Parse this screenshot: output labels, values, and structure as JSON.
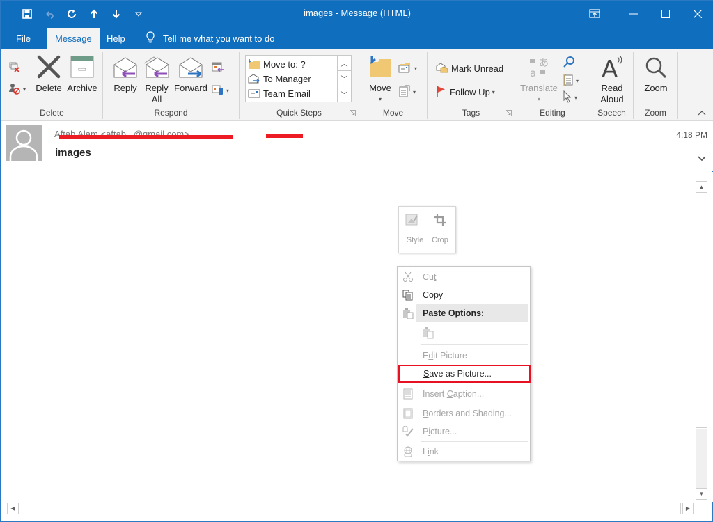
{
  "window": {
    "title": "images  -  Message (HTML)",
    "accent_color": "#106ebe",
    "quick_access": [
      {
        "icon": "save-icon"
      },
      {
        "icon": "undo-icon",
        "disabled": true
      },
      {
        "icon": "redo-icon"
      },
      {
        "icon": "previous-item-icon"
      },
      {
        "icon": "next-item-icon"
      },
      {
        "icon": "customize-qat-icon"
      }
    ],
    "controls": [
      "ribbon-display-options-icon",
      "minimize-icon",
      "maximize-icon",
      "close-icon"
    ]
  },
  "menu": {
    "tabs": [
      {
        "label": "File",
        "active": false
      },
      {
        "label": "Message",
        "active": true
      },
      {
        "label": "Help",
        "active": false
      }
    ],
    "tell_me": "Tell me what you want to do"
  },
  "ribbon": {
    "groups": {
      "delete": {
        "label": "Delete",
        "ignore_icon": "ignore-icon",
        "junk_icon": "block-sender-icon",
        "delete_label": "Delete",
        "archive_label": "Archive"
      },
      "respond": {
        "label": "Respond",
        "reply_label": "Reply",
        "reply_all_label_1": "Reply",
        "reply_all_label_2": "All",
        "forward_label": "Forward"
      },
      "quick_steps": {
        "label": "Quick Steps",
        "items": [
          "Move to: ?",
          "To Manager",
          "Team Email"
        ]
      },
      "move": {
        "label": "Move",
        "move_label": "Move"
      },
      "tags": {
        "label": "Tags",
        "mark_unread": "Mark Unread",
        "follow_up": "Follow Up"
      },
      "editing": {
        "label": "Editing",
        "translate": "Translate"
      },
      "speech": {
        "label": "Speech",
        "read_aloud_1": "Read",
        "read_aloud_2": "Aloud"
      },
      "zoom": {
        "label": "Zoom",
        "zoom_label": "Zoom"
      }
    }
  },
  "message": {
    "sender_visible": "Aftab Alam <aftab...@gmail.com>",
    "subject": "images",
    "time": "4:18 PM"
  },
  "mini_toolbar": {
    "style_label": "Style",
    "crop_label": "Crop"
  },
  "context_menu": {
    "items": [
      {
        "pre": "Cu",
        "u": "t",
        "post": "",
        "disabled": true,
        "icon": "cut-icon"
      },
      {
        "pre": "",
        "u": "C",
        "post": "opy",
        "disabled": false,
        "icon": "copy-icon"
      },
      {
        "label": "Paste Options:",
        "header": true,
        "icon": "paste-icon"
      },
      {
        "icon": "paste-keep-icon",
        "disabled": true
      },
      {
        "pre": "E",
        "u": "d",
        "post": "it Picture",
        "disabled": true
      },
      {
        "pre": "",
        "u": "S",
        "post": "ave as Picture...",
        "disabled": false,
        "highlighted": true
      },
      {
        "pre": "Insert ",
        "u": "C",
        "post": "aption...",
        "disabled": true,
        "icon": "insert-caption-icon"
      },
      {
        "pre": "",
        "u": "B",
        "post": "orders and Shading...",
        "disabled": true,
        "icon": "borders-icon"
      },
      {
        "pre": "P",
        "u": "i",
        "post": "cture...",
        "disabled": true,
        "icon": "format-picture-icon"
      },
      {
        "pre": "L",
        "u": "i",
        "post": "nk",
        "disabled": true,
        "icon": "link-icon"
      }
    ],
    "highlight_color": "#e81123"
  }
}
